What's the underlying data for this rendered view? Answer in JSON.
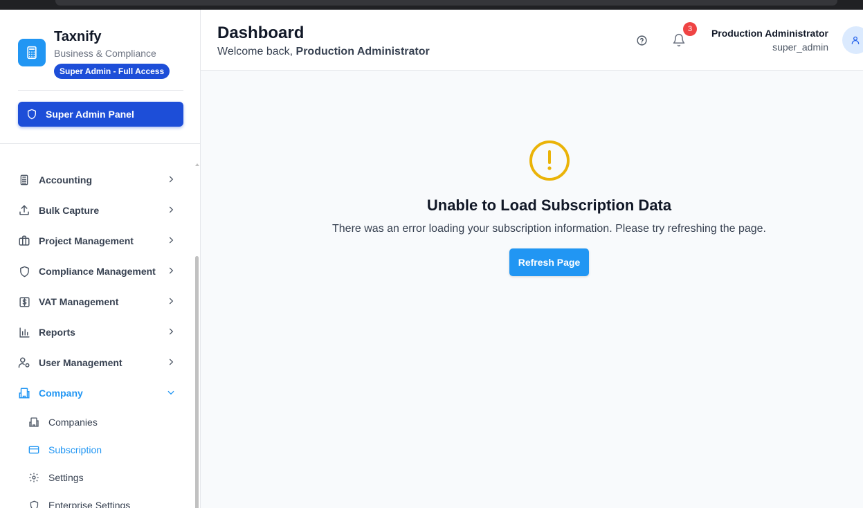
{
  "brand": {
    "name": "Taxnify",
    "subtitle": "Business & Compliance",
    "badge": "Super Admin - Full Access"
  },
  "sidebar": {
    "panel_button": "Super Admin Panel",
    "items": [
      {
        "label": "Accounting",
        "icon": "calculator-icon"
      },
      {
        "label": "Bulk Capture",
        "icon": "upload-icon"
      },
      {
        "label": "Project Management",
        "icon": "briefcase-icon"
      },
      {
        "label": "Compliance Management",
        "icon": "shield-icon"
      },
      {
        "label": "VAT Management",
        "icon": "dollar-square-icon"
      },
      {
        "label": "Reports",
        "icon": "bar-chart-icon"
      },
      {
        "label": "User Management",
        "icon": "user-settings-icon"
      },
      {
        "label": "Company",
        "icon": "building-icon",
        "active": true,
        "expanded": true
      }
    ],
    "subitems": [
      {
        "label": "Companies",
        "icon": "building-icon"
      },
      {
        "label": "Subscription",
        "icon": "credit-card-icon",
        "active": true
      },
      {
        "label": "Settings",
        "icon": "gear-icon"
      },
      {
        "label": "Enterprise Settings",
        "icon": "shield-icon"
      }
    ]
  },
  "header": {
    "title": "Dashboard",
    "welcome_prefix": "Welcome back, ",
    "welcome_name": "Production Administrator",
    "notification_count": "3",
    "user_name": "Production Administrator",
    "user_role": "super_admin"
  },
  "error": {
    "title": "Unable to Load Subscription Data",
    "message": "There was an error loading your subscription information. Please try refreshing the page.",
    "button": "Refresh Page"
  },
  "colors": {
    "accent": "#2196f3",
    "admin": "#1d4ed8",
    "warning": "#eab308",
    "badge": "#ef4444"
  }
}
